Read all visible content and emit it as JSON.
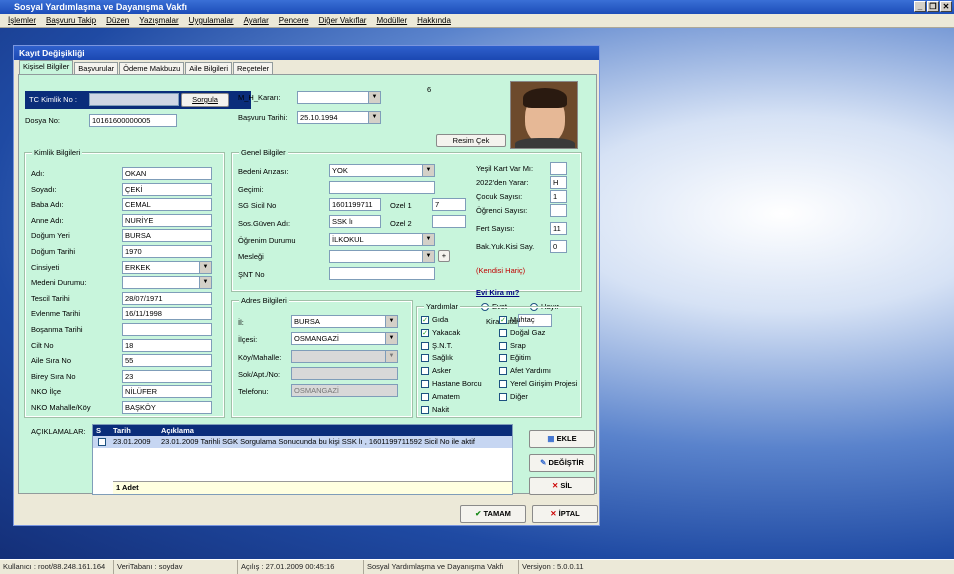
{
  "app": {
    "title": "Sosyal Yardımlaşma ve Dayanışma Vakfı"
  },
  "menu": [
    "İşlemler",
    "Başvuru Takip",
    "Düzen",
    "Yazışmalar",
    "Uygulamalar",
    "Ayarlar",
    "Pencere",
    "Diğer Vakıflar",
    "Modüller",
    "Hakkında"
  ],
  "dialog": {
    "title": "Kayıt Değişikliği",
    "tabs": [
      "Kişisel Bilgiler",
      "Başvurular",
      "Ödeme Makbuzu",
      "Aile Bilgileri",
      "Reçeteler"
    ]
  },
  "top": {
    "tc_label": "TC Kimlik No :",
    "tc_value": "",
    "sorgula": "Sorgula",
    "dosya_label": "Dosya No:",
    "dosya_value": "10161600000005",
    "mh_label": "M_H_Kararı:",
    "mh_value": "",
    "basvuru_label": "Başvuru Tarihi:",
    "basvuru_value": "25.10.1994",
    "number": "6",
    "resim_btn": "Resim Çek"
  },
  "kimlik": {
    "title": "Kimlik Bilgileri",
    "fields": [
      {
        "label": "Adı:",
        "value": "OKAN",
        "type": "text"
      },
      {
        "label": "Soyadı:",
        "value": "ÇEKİ",
        "type": "text"
      },
      {
        "label": "Baba Adı:",
        "value": "CEMAL",
        "type": "text"
      },
      {
        "label": "Anne Adı:",
        "value": "NURİYE",
        "type": "text"
      },
      {
        "label": "Doğum Yeri",
        "value": "BURSA",
        "type": "text"
      },
      {
        "label": "Doğum Tarihi",
        "value": "1970",
        "type": "text"
      },
      {
        "label": "Cinsiyeti",
        "value": "ERKEK",
        "type": "select"
      },
      {
        "label": "Medeni Durumu:",
        "value": "",
        "type": "select"
      },
      {
        "label": "Tescil Tarihi",
        "value": "28/07/1971",
        "type": "text"
      },
      {
        "label": "Evlenme Tarihi",
        "value": "16/11/1998",
        "type": "text"
      },
      {
        "label": "Boşanma Tarihi",
        "value": "",
        "type": "text"
      },
      {
        "label": "Cilt No",
        "value": "18",
        "type": "text"
      },
      {
        "label": "Aile Sıra No",
        "value": "55",
        "type": "text"
      },
      {
        "label": "Birey Sıra No",
        "value": "23",
        "type": "text"
      },
      {
        "label": "NKO İlçe",
        "value": "NİLÜFER",
        "type": "text"
      },
      {
        "label": "NKO Mahalle/Köy",
        "value": "BAŞKÖY",
        "type": "text"
      }
    ]
  },
  "genel": {
    "title": "Genel Bilgiler",
    "bedeni_label": "Bedeni Arızası:",
    "bedeni_value": "YOK",
    "gecimi_label": "Geçimi:",
    "gecimi_value": "",
    "sg_label": "SG Sicil No",
    "sg_value": "1601199711",
    "ozel1_label": "Ozel 1",
    "ozel1_value": "7",
    "sos_label": "Sos.Güven Adı:",
    "sos_value": "SSK lı",
    "ozel2_label": "Ozel 2",
    "ozel2_value": "",
    "ogrenim_label": "Öğrenim Durumu",
    "ogrenim_value": "İLKOKUL",
    "meslegi_label": "Mesleği",
    "meslegi_value": "",
    "snt_label": "ŞNT No",
    "snt_value": "",
    "plus": "+",
    "right": [
      {
        "label": "Yeşil Kart Var Mı:",
        "value": ""
      },
      {
        "label": "2022'den Yarar:",
        "value": "H"
      },
      {
        "label": "Çocuk Sayısı:",
        "value": "1"
      },
      {
        "label": "Öğrenci Sayısı:",
        "value": ""
      },
      {
        "label": "Fert Sayısı:",
        "value": "11"
      },
      {
        "label": "Bak.Yuk.Kisi Say.",
        "value": "0"
      }
    ],
    "kendisi": "(Kendisi Hariç)",
    "evi_kira": "Evi Kira mı?",
    "evet": "Evet",
    "hayir": "Hayır",
    "kira_label": "Kira Tutarı:",
    "kira_value": ""
  },
  "adres": {
    "title": "Adres Bilgileri",
    "il_label": "İl:",
    "il_value": "BURSA",
    "ilce_label": "İlçesi:",
    "ilce_value": "OSMANGAZİ",
    "koy_label": "Köy/Mahalle:",
    "koy_value": "",
    "sok_label": "Sok/Apt./No:",
    "sok_value": "",
    "tel_label": "Telefonu:",
    "tel_value": "OSMANGAZİ"
  },
  "yardimlar": {
    "title": "Yardımlar",
    "left": [
      {
        "label": "Gıda",
        "checked": true
      },
      {
        "label": "Yakacak",
        "checked": true
      },
      {
        "label": "Ş.N.T.",
        "checked": false
      },
      {
        "label": "Sağlık",
        "checked": false
      },
      {
        "label": "Asker",
        "checked": false
      },
      {
        "label": "Hastane Borcu",
        "checked": false
      },
      {
        "label": "Amatem",
        "checked": false
      },
      {
        "label": "Nakit",
        "checked": false
      }
    ],
    "right": [
      {
        "label": "Muhtaç",
        "checked": true
      },
      {
        "label": "Doğal Gaz",
        "checked": false
      },
      {
        "label": "Srap",
        "checked": false
      },
      {
        "label": "Eğitim",
        "checked": false
      },
      {
        "label": "Afet Yardımı",
        "checked": false
      },
      {
        "label": "Yerel Girişim Projesi",
        "checked": false
      },
      {
        "label": "Diğer",
        "checked": false
      }
    ]
  },
  "aciklamalar": {
    "label": "AÇIKLAMALAR:",
    "headers": [
      "S",
      "Tarih",
      "Açıklama"
    ],
    "rows": [
      {
        "tarih": "23.01.2009",
        "aciklama": "23.01.2009 Tarihli SGK Sorgulama Sonucunda bu kişi SSK lı , 1601199711592 Sicil No ile aktif"
      }
    ],
    "footer": "1 Adet"
  },
  "buttons": {
    "ekle": "EKLE",
    "degistir": "DEĞİŞTİR",
    "sil": "SİL",
    "tamam": "TAMAM",
    "iptal": "İPTAL"
  },
  "status": [
    "Kullanıcı : root/88.248.161.164",
    "VeriTabanı : soydav",
    "Açılış : 27.01.2009 00:45:16",
    "Sosyal Yardımlaşma ve Dayanışma Vakfı",
    "Versiyon : 5.0.0.11"
  ]
}
